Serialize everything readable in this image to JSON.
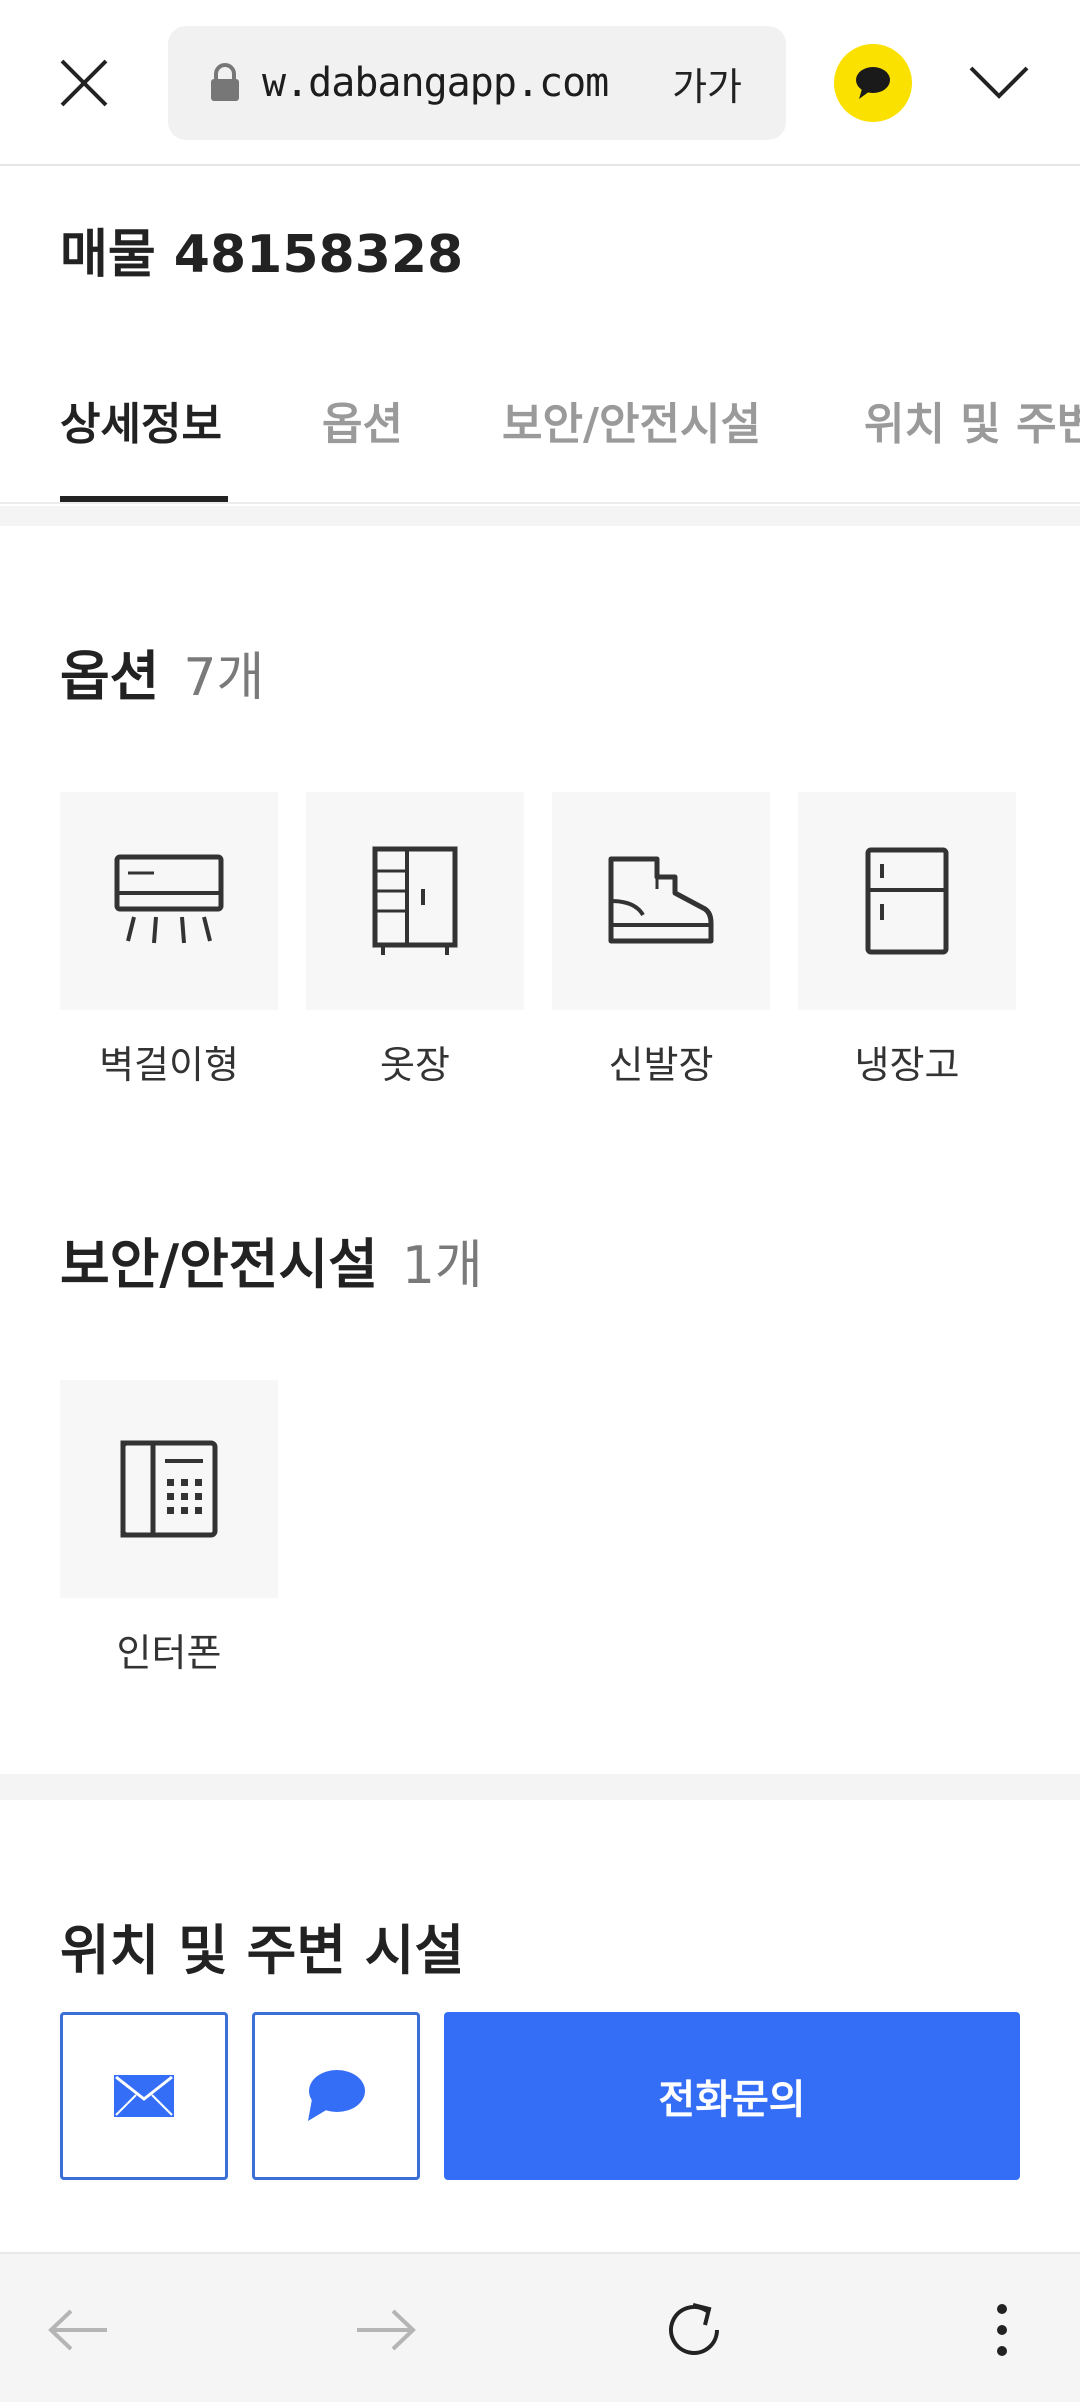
{
  "browser": {
    "url": "w.dabangapp.com",
    "text_size_label": "가가",
    "icons": [
      "close-icon",
      "lock-icon",
      "kakaotalk-icon",
      "chevron-down-icon"
    ]
  },
  "listing": {
    "title": "매물 48158328"
  },
  "tabs": [
    {
      "label": "상세정보",
      "active": true
    },
    {
      "label": "옵션",
      "active": false
    },
    {
      "label": "보안/안전시설",
      "active": false
    },
    {
      "label": "위치 및 주변",
      "active": false
    }
  ],
  "options_section": {
    "title": "옵션",
    "count": "7개",
    "items": [
      {
        "label": "벽걸이형",
        "icon": "wall-air-conditioner-icon"
      },
      {
        "label": "옷장",
        "icon": "wardrobe-icon"
      },
      {
        "label": "신발장",
        "icon": "shoe-cabinet-icon"
      },
      {
        "label": "냉장고",
        "icon": "refrigerator-icon"
      }
    ]
  },
  "security_section": {
    "title": "보안/안전시설",
    "count": "1개",
    "items": [
      {
        "label": "인터폰",
        "icon": "intercom-icon"
      }
    ]
  },
  "location_section": {
    "title": "위치 및 주변 시설"
  },
  "actions": {
    "call_label": "전화문의",
    "accent_color": "#356ef6",
    "icons": [
      "mail-icon",
      "chat-bubble-icon"
    ]
  },
  "navbar": {
    "icons": [
      "back-arrow-icon",
      "forward-arrow-icon",
      "refresh-icon",
      "more-vertical-icon"
    ]
  },
  "colors": {
    "kakao_yellow": "#fae100",
    "call_blue": "#356ef6"
  }
}
